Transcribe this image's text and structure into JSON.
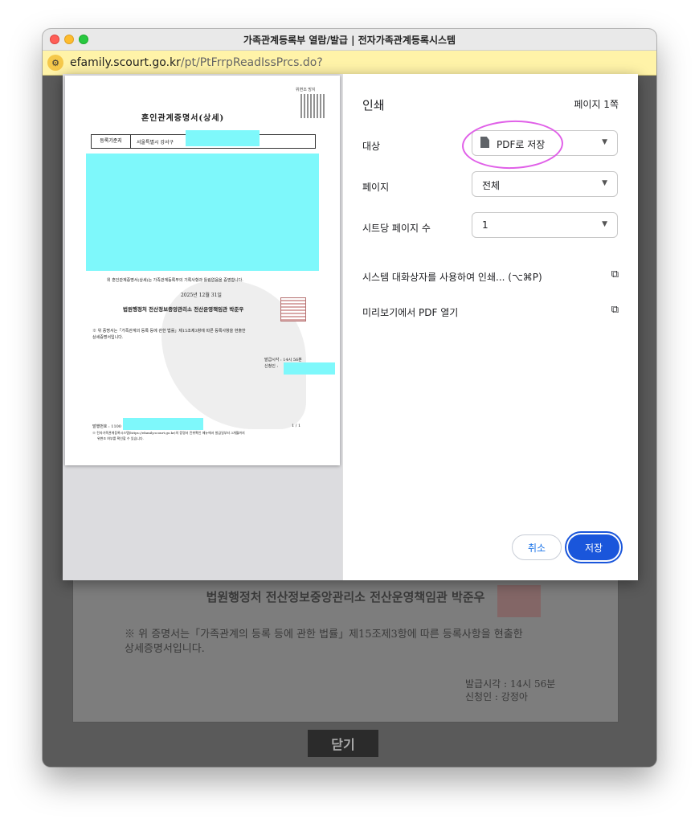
{
  "window": {
    "title": "가족관계등록부 열람/발급 | 전자가족관계등록시스템",
    "url_host": "efamily.scourt.go.kr",
    "url_path": "/pt/PtFrrpReadIssPrcs.do?"
  },
  "background": {
    "line1": "법원행정처 전산정보중앙관리소 전산운영책임관 박준우",
    "line2": "※ 위 증명서는「가족관계의 등록 등에 관한 법률」제15조제3항에 따른 등록사항을 현출한",
    "line3": "상세증명서입니다.",
    "issue_time": "발급시각 : 14시 56분",
    "applicant": "신청인 : 강정아",
    "close_button": "닫기"
  },
  "preview": {
    "doc_title": "혼인관계증명서(상세)",
    "qr_label": "위변조 방지",
    "row_label": "등록기준지",
    "row_value": "서울특별시 강서구",
    "certify_text": "위 혼인관계증명서(상세)는 가족관계등록부의 기록사항과 틀림없음을 증명합니다.",
    "date": "2025년 12월 31일",
    "issuer": "법원행정처 전산정보중앙관리소 전산운영책임관 박준우",
    "note_line1": "※ 위 증명서는「가족관계의 등록 등에 관한 법률」제15조제3항에 따른 등록사항을 현출한",
    "note_line2": "상세증명서입니다.",
    "issue_time": "발급시각 : 14시 56분",
    "applicant": "신청인 :",
    "doc_number": "발행번호 : 1100",
    "page_number": "1 / 1",
    "footer_line1": "※ 전자가족관계등록시스템(https://efamily.scourt.go.kr)의 증명서 진위확인 메뉴에서 발급일부터 3개월까지",
    "footer_line2": "위변조 여부를 확인할 수 있습니다."
  },
  "print": {
    "title": "인쇄",
    "page_count": "페이지 1쪽",
    "destination_label": "대상",
    "destination_value": "PDF로 저장",
    "pages_label": "페이지",
    "pages_value": "전체",
    "per_sheet_label": "시트당 페이지 수",
    "per_sheet_value": "1",
    "system_dialog": "시스템 대화상자를 사용하여 인쇄... (⌥⌘P)",
    "open_preview": "미리보기에서 PDF 열기",
    "cancel": "취소",
    "save": "저장"
  },
  "colors": {
    "accent": "#1a56db",
    "highlight": "#e060e8",
    "redaction": "#7ef8fb"
  }
}
